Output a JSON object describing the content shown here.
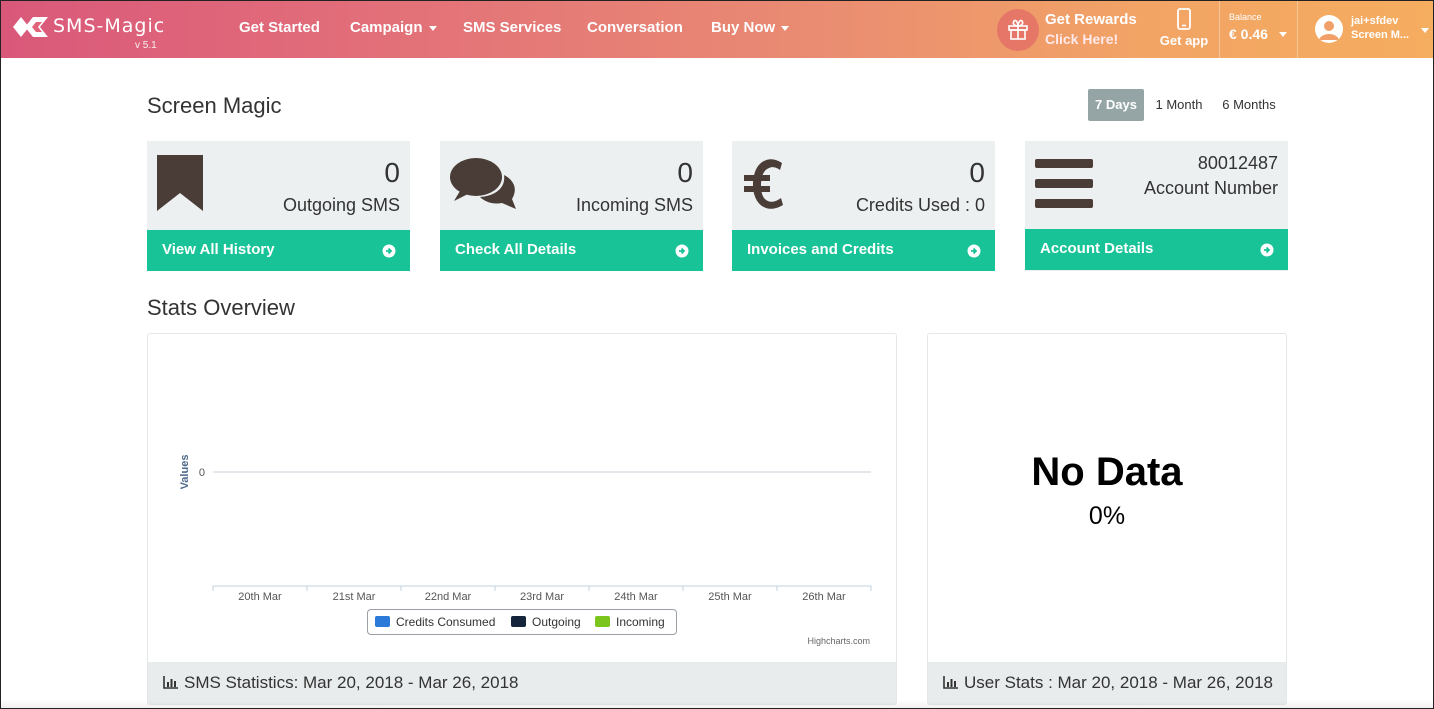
{
  "app": {
    "logo_text": "SMS-Magic",
    "version": "v 5.1"
  },
  "nav": {
    "items": [
      {
        "label": "Get Started"
      },
      {
        "label": "Campaign"
      },
      {
        "label": "SMS Services"
      },
      {
        "label": "Conversation"
      },
      {
        "label": "Buy Now"
      }
    ],
    "rewards_title": "Get Rewards",
    "rewards_sub": "Click Here!",
    "getapp": "Get app",
    "balance_label": "Balance",
    "balance_value": "€ 0.46",
    "user_name": "jai+sfdev",
    "user_org": "Screen M..."
  },
  "page": {
    "title": "Screen Magic",
    "ranges": [
      "7 Days",
      "1 Month",
      "6 Months"
    ],
    "active_range": "7 Days"
  },
  "cards": [
    {
      "icon": "bookmark-icon",
      "value": "0",
      "label": "Outgoing SMS",
      "footer": "View All History"
    },
    {
      "icon": "chat-bubbles-icon",
      "value": "0",
      "label": "Incoming SMS",
      "footer": "Check All Details"
    },
    {
      "icon": "euro-icon",
      "value": "0",
      "label": "Credits Used : 0",
      "footer": "Invoices and Credits"
    },
    {
      "icon": "menu-bars-icon",
      "value": "80012487",
      "label": "Account Number",
      "footer": "Account Details"
    }
  ],
  "stats": {
    "section_title": "Stats Overview",
    "sms_footer": "SMS Statistics: Mar 20, 2018 - Mar 26, 2018",
    "user_footer": "User Stats : Mar 20, 2018 - Mar 26, 2018",
    "no_data": "No Data",
    "no_data_pct": "0%",
    "credits_text": "Highcharts.com"
  },
  "colors": {
    "accent": "#17c397",
    "card_bg": "#ecf0f1",
    "series_credits": "#2b7ad9",
    "series_outgoing": "#14243a",
    "series_incoming": "#7cc51c"
  },
  "chart_data": {
    "type": "line",
    "categories": [
      "20th Mar",
      "21st Mar",
      "22nd Mar",
      "23rd Mar",
      "24th Mar",
      "25th Mar",
      "26th Mar"
    ],
    "ylabel": "Values",
    "yticks": [
      "0"
    ],
    "series": [
      {
        "name": "Credits Consumed",
        "color": "#2b7ad9",
        "values": [
          0,
          0,
          0,
          0,
          0,
          0,
          0
        ]
      },
      {
        "name": "Outgoing",
        "color": "#14243a",
        "values": [
          0,
          0,
          0,
          0,
          0,
          0,
          0
        ]
      },
      {
        "name": "Incoming",
        "color": "#7cc51c",
        "values": [
          0,
          0,
          0,
          0,
          0,
          0,
          0
        ]
      }
    ],
    "legend": "bottom-center"
  }
}
